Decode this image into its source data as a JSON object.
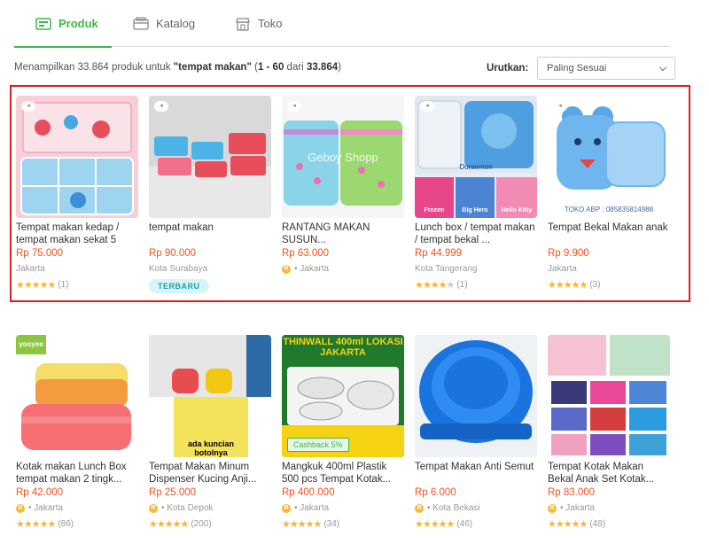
{
  "tabs": [
    {
      "label": "Produk",
      "icon": "product-icon",
      "active": true
    },
    {
      "label": "Katalog",
      "icon": "catalog-icon",
      "active": false
    },
    {
      "label": "Toko",
      "icon": "store-icon",
      "active": false
    }
  ],
  "summary": {
    "prefix": "Menampilkan 33.864 produk untuk ",
    "query": "\"tempat makan\"",
    "range_open": " (",
    "range": "1 - 60",
    "range_of": " dari ",
    "total": "33.864",
    "range_close": ")"
  },
  "sort": {
    "label": "Urutkan:",
    "value": "Paling Sesuai"
  },
  "colors": {
    "accent": "#42b549",
    "price": "#f4511e",
    "highlight": "#e11c1c",
    "star": "#fbb430"
  },
  "products": [
    {
      "name": "Tempat makan kedap / tempat makan sekat 5",
      "price": "Rp 75.000",
      "location": "Jakarta",
      "official_badge": false,
      "stars": 5,
      "reviews": "(1)",
      "is_ad": true,
      "tag": "",
      "caption": "",
      "cashback": ""
    },
    {
      "name": "tempat makan",
      "price": "Rp 90.000",
      "location": "Kota Surabaya",
      "official_badge": false,
      "stars": 0,
      "reviews": "",
      "is_ad": true,
      "tag": "TERBARU",
      "caption": "",
      "cashback": ""
    },
    {
      "name": "RANTANG MAKAN SUSUN...",
      "price": "Rp 63.000",
      "location": "Jakarta",
      "official_badge": true,
      "stars": 0,
      "reviews": "",
      "is_ad": true,
      "tag": "",
      "caption": "Geboy Shopp",
      "cashback": ""
    },
    {
      "name": "Lunch box / tempat makan / tempat bekal ...",
      "price": "Rp 44.999",
      "location": "Kota Tangerang",
      "official_badge": false,
      "stars": 4,
      "reviews": "(1)",
      "is_ad": true,
      "tag": "",
      "caption": "Doraemon",
      "cashback": ""
    },
    {
      "name": "Tempat Bekal Makan anak",
      "price": "Rp 9.900",
      "location": "Jakarta",
      "official_badge": false,
      "stars": 5,
      "reviews": "(3)",
      "is_ad": true,
      "tag": "",
      "caption": "TOKO ABP : 085835814988",
      "cashback": ""
    },
    {
      "name": "Kotak makan Lunch Box tempat makan 2 tingk...",
      "price": "Rp 42.000",
      "location": "Jakarta",
      "official_badge": true,
      "stars": 5,
      "reviews": "(86)",
      "is_ad": false,
      "tag": "",
      "caption": "yooyee",
      "cashback": ""
    },
    {
      "name": "Tempat Makan Minum Dispenser Kucing Anji...",
      "price": "Rp 25.000",
      "location": "Kota Depok",
      "official_badge": true,
      "stars": 5,
      "reviews": "(200)",
      "is_ad": false,
      "tag": "",
      "caption": "ada kuncian botolnya",
      "cashback": ""
    },
    {
      "name": "Mangkuk 400ml Plastik 500 pcs Tempat Kotak...",
      "price": "Rp 400.000",
      "location": "Jakarta",
      "official_badge": true,
      "stars": 5,
      "reviews": "(34)",
      "is_ad": false,
      "tag": "",
      "caption": "THINWALL 400ml LOKASI JAKARTA",
      "cashback": "Cashback 5%"
    },
    {
      "name": "Tempat Makan Anti Semut",
      "price": "Rp 6.000",
      "location": "Kota Bekasi",
      "official_badge": true,
      "stars": 5,
      "reviews": "(46)",
      "is_ad": false,
      "tag": "",
      "caption": "",
      "cashback": ""
    },
    {
      "name": "Tempat Kotak Makan Bekal Anak Set Kotak...",
      "price": "Rp 83.000",
      "location": "Jakarta",
      "official_badge": true,
      "stars": 5,
      "reviews": "(48)",
      "is_ad": false,
      "tag": "",
      "caption": "",
      "cashback": ""
    }
  ]
}
